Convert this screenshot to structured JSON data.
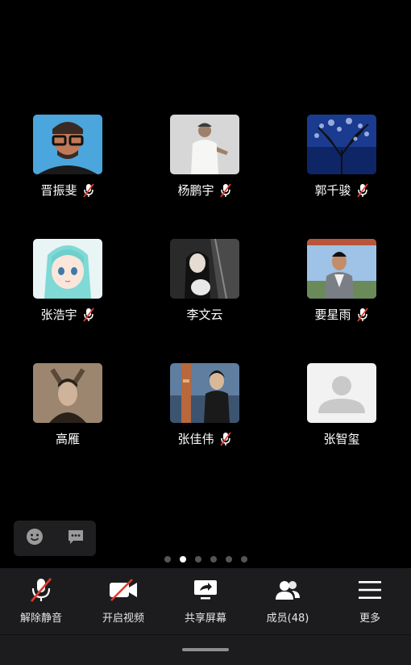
{
  "participants": [
    {
      "name": "晋振斐",
      "muted": true
    },
    {
      "name": "杨鹏宇",
      "muted": true
    },
    {
      "name": "郭千骏",
      "muted": true
    },
    {
      "name": "张浩宇",
      "muted": true
    },
    {
      "name": "李文云",
      "muted": false
    },
    {
      "name": "要星雨",
      "muted": true
    },
    {
      "name": "高雁",
      "muted": false
    },
    {
      "name": "张佳伟",
      "muted": true
    },
    {
      "name": "张智玺",
      "muted": false
    }
  ],
  "pagination": {
    "total": 6,
    "active": 2
  },
  "toolbar": {
    "unmute_label": "解除静音",
    "video_label": "开启视频",
    "share_label": "共享屏幕",
    "members_label": "成员(48)",
    "more_label": "更多"
  },
  "colors": {
    "background": "#000000",
    "toolbar": "#1c1c1e",
    "mute_red": "#e23b30"
  }
}
